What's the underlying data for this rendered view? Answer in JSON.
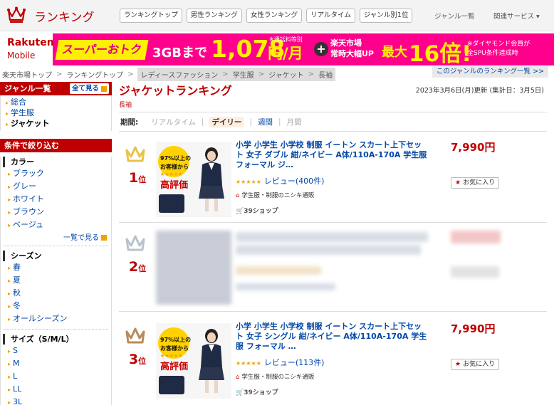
{
  "header": {
    "title": "ランキング",
    "nav": [
      "ランキングトップ",
      "男性ランキング",
      "女性ランキング",
      "リアルタイム",
      "ジャンル別1位"
    ],
    "right": [
      "ジャンル一覧",
      "関連サービス ▾"
    ]
  },
  "banner": {
    "brand": "Rakuten",
    "brand_sub": "Mobile",
    "catch": "スーパーおトク",
    "data_amount": "3GBまで",
    "price": "1,078",
    "price_unit": "円/月",
    "price_note": "※通話料等別",
    "market": "楽天市場",
    "market_sub": "常時大幅UP",
    "max_label": "最大",
    "max_value": "16倍!",
    "note_line1": "※ダイヤモンド会員が",
    "note_line2": "全SPU条件達成時"
  },
  "breadcrumb": {
    "items": [
      "楽天市場トップ",
      "ランキングトップ"
    ],
    "highlighted": [
      "レディースファッション",
      "学生服",
      "ジャケット",
      "長袖"
    ],
    "right_link": "このジャンルのランキング一覧 >>"
  },
  "sidebar": {
    "genre_title": "ジャンル一覧",
    "show_all": "全て見る",
    "genres": [
      "総合",
      "学生服",
      "ジャケット"
    ],
    "filter_title": "条件で絞り込む",
    "color_title": "カラー",
    "colors": [
      "ブラック",
      "グレー",
      "ホワイト",
      "ブラウン",
      "ベージュ"
    ],
    "more": "一覧で見る",
    "season_title": "シーズン",
    "seasons": [
      "春",
      "夏",
      "秋",
      "冬",
      "オールシーズン"
    ],
    "size_title": "サイズ（S/M/L）",
    "sizes": [
      "S",
      "M",
      "L",
      "LL",
      "3L"
    ]
  },
  "main": {
    "title": "ジャケットランキング",
    "subtitle": "長袖",
    "updated": "2023年3月6日(月)更新 (集計日：3月5日)",
    "period_label": "期間:",
    "periods": [
      "リアルタイム",
      "デイリー",
      "週間",
      "月間"
    ]
  },
  "items": [
    {
      "rank_num": "1",
      "rank_unit": "位",
      "crown_color": "#e8c34a",
      "name": "小学 小学生 小学校 制服 イートン スカート上下セット 女子 ダブル 紺/ネイビー A体/110A-170A 学生服 フォーマル ジ…",
      "review": "レビュー(400件)",
      "shop": "学生服・制服のニシキ通販",
      "points": "39ショップ",
      "price": "7,990円",
      "fav": "お気に入り",
      "thumb_cap1": "97%以上の",
      "thumb_cap2": "お客様から",
      "thumb_big": "高評価"
    },
    {
      "rank_num": "2",
      "rank_unit": "位",
      "crown_color": "#b9c2cc"
    },
    {
      "rank_num": "3",
      "rank_unit": "位",
      "crown_color": "#b88a5a",
      "name": "小学 小学生 小学校 制服 イートン スカート上下セット 女子 シングル 紺/ネイビー A体/110A-170A 学生服 フォーマル …",
      "review": "レビュー(113件)",
      "shop": "学生服・制服のニシキ通販",
      "points": "39ショップ",
      "price": "7,990円",
      "fav": "お気に入り",
      "thumb_cap1": "97%以上の",
      "thumb_cap2": "お客様から",
      "thumb_big": "高評価"
    }
  ]
}
